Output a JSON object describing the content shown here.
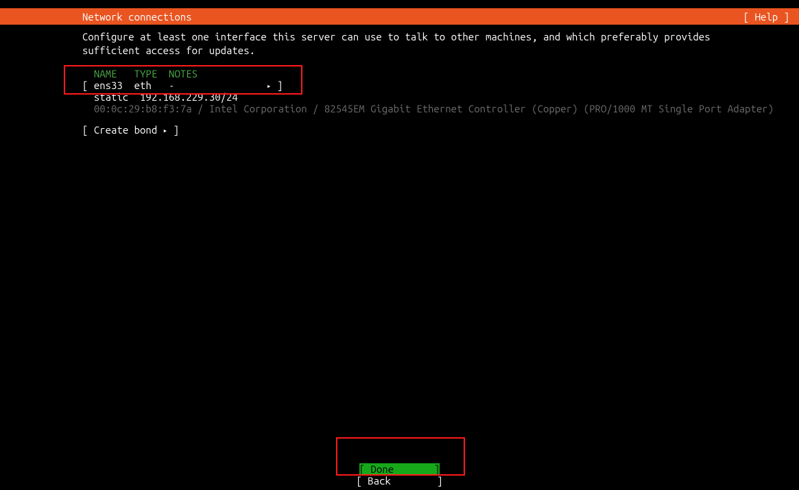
{
  "header": {
    "title": "Network connections",
    "help_label": "[ Help ]"
  },
  "instruction": "Configure at least one interface this server can use to talk to other machines, and which preferably provides sufficient access for updates.",
  "columns": {
    "name": "NAME",
    "type": "TYPE",
    "notes": "NOTES"
  },
  "interface": {
    "open_bracket": "[",
    "name": "ens33",
    "type": "eth",
    "notes_dash": "-",
    "arrow": "▸",
    "close_bracket": "]",
    "method": "static",
    "address": "192.168.229.30/24",
    "hwinfo": "00:0c:29:b8:f3:7a / Intel Corporation / 82545EM Gigabit Ethernet Controller (Copper) (PRO/1000 MT Single Port Adapter)"
  },
  "bond": {
    "open": "[ ",
    "label": "Create bond",
    "arrow": "▸",
    "close": " ]"
  },
  "footer": {
    "open": "[ ",
    "close": " ]",
    "done_prefix": "D",
    "done_rest": "one",
    "done_pad": "      ",
    "back_label": "Back",
    "back_pad": "       "
  }
}
